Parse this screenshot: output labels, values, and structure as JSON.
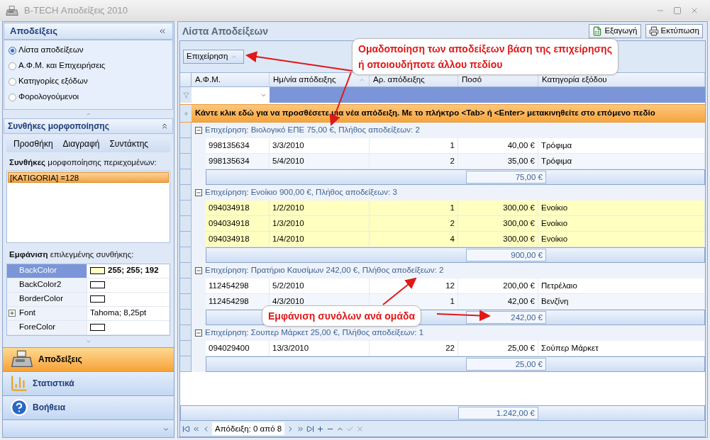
{
  "window": {
    "title": "B-TECH Αποδείξεις 2010"
  },
  "sidebar": {
    "title": "Αποδείξεις",
    "items": [
      {
        "label": "Λίστα αποδείξεων",
        "selected": true
      },
      {
        "label": "Α.Φ.Μ. και Επιχειρήσεις",
        "selected": false
      },
      {
        "label": "Κατηγορίες εξόδων",
        "selected": false
      },
      {
        "label": "Φορολογούμενοι",
        "selected": false
      }
    ],
    "conditions": {
      "title": "Συνθήκες μορφοποίησης",
      "toolbar": [
        "Προσθήκη",
        "Διαγραφή",
        "Συντάκτης"
      ],
      "label": "**Συνθήκες** μορφοποίησης περιεχομένων:",
      "list": [
        {
          "text": "[KATIGORIA] =128",
          "selected": true
        }
      ],
      "appearance_label": "**Εμφάνιση** επιλεγμένης συνθήκης:",
      "properties": [
        {
          "name": "BackColor",
          "kind": "color",
          "color": "#ffffc0",
          "value": "255; 255; 192",
          "selected": true,
          "expandable": false
        },
        {
          "name": "BackColor2",
          "kind": "color",
          "color": "#ffffff",
          "selected": false,
          "expandable": false
        },
        {
          "name": "BorderColor",
          "kind": "color",
          "color": "#ffffff",
          "selected": false,
          "expandable": false
        },
        {
          "name": "Font",
          "kind": "text",
          "value": "Tahoma; 8,25pt",
          "selected": false,
          "expandable": true
        },
        {
          "name": "ForeColor",
          "kind": "color",
          "color": "#ffffff",
          "selected": false,
          "expandable": false
        }
      ]
    },
    "nav": [
      {
        "label": "Αποδείξεις",
        "kind": "receipts",
        "selected": true
      },
      {
        "label": "Στατιστικά",
        "kind": "stats",
        "selected": false
      },
      {
        "label": "Βοήθεια",
        "kind": "help",
        "selected": false
      }
    ]
  },
  "main": {
    "title": "Λίστα Αποδείξεων",
    "actions": [
      {
        "label": "Εξαγωγή",
        "kind": "export"
      },
      {
        "label": "Εκτύπωση",
        "kind": "print"
      }
    ],
    "group_by": "Επιχείρηση",
    "columns": [
      {
        "label": "Α.Φ.Μ.",
        "sorted": false
      },
      {
        "label": "Ημ/νία απόδειξης",
        "sorted": true
      },
      {
        "label": "Αρ. απόδειξης",
        "sorted": false
      },
      {
        "label": "Ποσό",
        "sorted": false
      },
      {
        "label": "Κατηγορία εξόδου",
        "sorted": false
      }
    ],
    "new_row_text": "Κάντε κλικ εδώ για να προσθέσετε μια νέα απόδειξη. Με το πλήκτρο <Tab> ή <Enter> μετακινηθείτε στο επόμενο πεδίο",
    "groups": [
      {
        "header": "Επιχείρηση: Βιολογικό ΕΠΕ 75,00 €, Πλήθος αποδείξεων: 2",
        "expanded": true,
        "total": "75,00 €",
        "rows": [
          {
            "cells": [
              "998135634",
              "3/3/2010",
              "1",
              "40,00 €",
              "Τρόφιμα"
            ],
            "highlighted": false
          },
          {
            "cells": [
              "998135634",
              "5/4/2010",
              "2",
              "35,00 €",
              "Τρόφιμα"
            ],
            "highlighted": false
          }
        ]
      },
      {
        "header": "Επιχείρηση: Ενοίκιο 900,00 €, Πλήθος αποδείξεων: 3",
        "expanded": true,
        "total": "900,00 €",
        "rows": [
          {
            "cells": [
              "094034918",
              "1/2/2010",
              "1",
              "300,00 €",
              "Ενοίκιο"
            ],
            "highlighted": true
          },
          {
            "cells": [
              "094034918",
              "1/3/2010",
              "2",
              "300,00 €",
              "Ενοίκιο"
            ],
            "highlighted": true
          },
          {
            "cells": [
              "094034918",
              "1/4/2010",
              "4",
              "300,00 €",
              "Ενοίκιο"
            ],
            "highlighted": true
          }
        ]
      },
      {
        "header": "Επιχείρηση: Πρατήριο Καυσίμων 242,00 €, Πλήθος αποδείξεων: 2",
        "expanded": true,
        "total": "242,00 €",
        "rows": [
          {
            "cells": [
              "112454298",
              "5/2/2010",
              "12",
              "200,00 €",
              "Πετρέλαιο"
            ],
            "highlighted": false
          },
          {
            "cells": [
              "112454298",
              "4/3/2010",
              "1",
              "42,00 €",
              "Βενζίνη"
            ],
            "highlighted": false
          }
        ]
      },
      {
        "header": "Επιχείρηση: Σουπερ Μάρκετ 25,00 €, Πλήθος αποδείξεων: 1",
        "expanded": true,
        "total": "25,00 €",
        "rows": [
          {
            "cells": [
              "094029400",
              "13/3/2010",
              "22",
              "25,00 €",
              "Σούπερ Μάρκετ"
            ],
            "highlighted": false
          }
        ]
      }
    ],
    "grand_total": "1.242,00 €",
    "navigator": {
      "label": "Απόδειξη: 0 από 8"
    }
  },
  "annotations": [
    {
      "lines": [
        "Ομαδοποίηση των αποδείξεων βάση της επιχείρησης",
        "ή οποιουδήποτε άλλου πεδίου"
      ]
    },
    {
      "lines": [
        "Εμφάνιση συνόλων ανά ομάδα"
      ]
    }
  ]
}
